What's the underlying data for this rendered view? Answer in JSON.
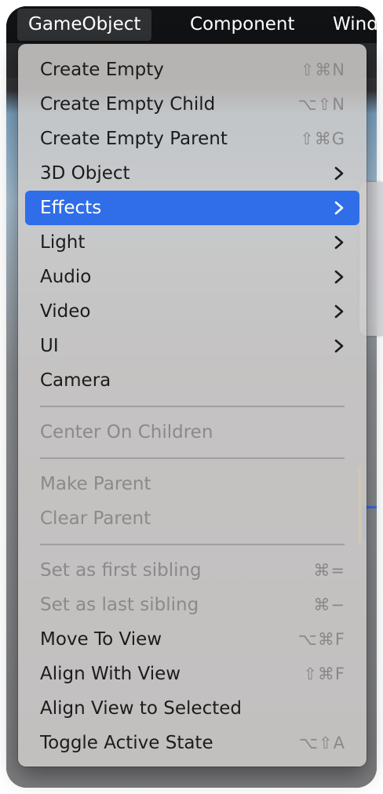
{
  "menubar": {
    "items": [
      {
        "label": "GameObject"
      },
      {
        "label": "Component"
      },
      {
        "label": "Wind"
      }
    ]
  },
  "menu": {
    "items": [
      {
        "label": "Create Empty",
        "shortcut": "⇧⌘N",
        "submenu": false,
        "disabled": false,
        "selected": false
      },
      {
        "label": "Create Empty Child",
        "shortcut": "⌥⇧N",
        "submenu": false,
        "disabled": false,
        "selected": false
      },
      {
        "label": "Create Empty Parent",
        "shortcut": "⇧⌘G",
        "submenu": false,
        "disabled": false,
        "selected": false
      },
      {
        "label": "3D Object",
        "shortcut": "",
        "submenu": true,
        "disabled": false,
        "selected": false
      },
      {
        "label": "Effects",
        "shortcut": "",
        "submenu": true,
        "disabled": false,
        "selected": true
      },
      {
        "label": "Light",
        "shortcut": "",
        "submenu": true,
        "disabled": false,
        "selected": false
      },
      {
        "label": "Audio",
        "shortcut": "",
        "submenu": true,
        "disabled": false,
        "selected": false
      },
      {
        "label": "Video",
        "shortcut": "",
        "submenu": true,
        "disabled": false,
        "selected": false
      },
      {
        "label": "UI",
        "shortcut": "",
        "submenu": true,
        "disabled": false,
        "selected": false
      },
      {
        "label": "Camera",
        "shortcut": "",
        "submenu": false,
        "disabled": false,
        "selected": false
      },
      {
        "label": "Center On Children",
        "shortcut": "",
        "submenu": false,
        "disabled": true,
        "selected": false
      },
      {
        "label": "Make Parent",
        "shortcut": "",
        "submenu": false,
        "disabled": true,
        "selected": false
      },
      {
        "label": "Clear Parent",
        "shortcut": "",
        "submenu": false,
        "disabled": true,
        "selected": false
      },
      {
        "label": "Set as first sibling",
        "shortcut": "⌘=",
        "submenu": false,
        "disabled": true,
        "selected": false
      },
      {
        "label": "Set as last sibling",
        "shortcut": "⌘−",
        "submenu": false,
        "disabled": true,
        "selected": false
      },
      {
        "label": "Move To View",
        "shortcut": "⌥⌘F",
        "submenu": false,
        "disabled": false,
        "selected": false
      },
      {
        "label": "Align With View",
        "shortcut": "⇧⌘F",
        "submenu": false,
        "disabled": false,
        "selected": false
      },
      {
        "label": "Align View to Selected",
        "shortcut": "",
        "submenu": false,
        "disabled": false,
        "selected": false
      },
      {
        "label": "Toggle Active State",
        "shortcut": "⌥⇧A",
        "submenu": false,
        "disabled": false,
        "selected": false
      }
    ]
  },
  "colors": {
    "selection": "#2f6ee8",
    "menu_bg": "#cdcbc9",
    "disabled_text": "#8c8a88"
  }
}
